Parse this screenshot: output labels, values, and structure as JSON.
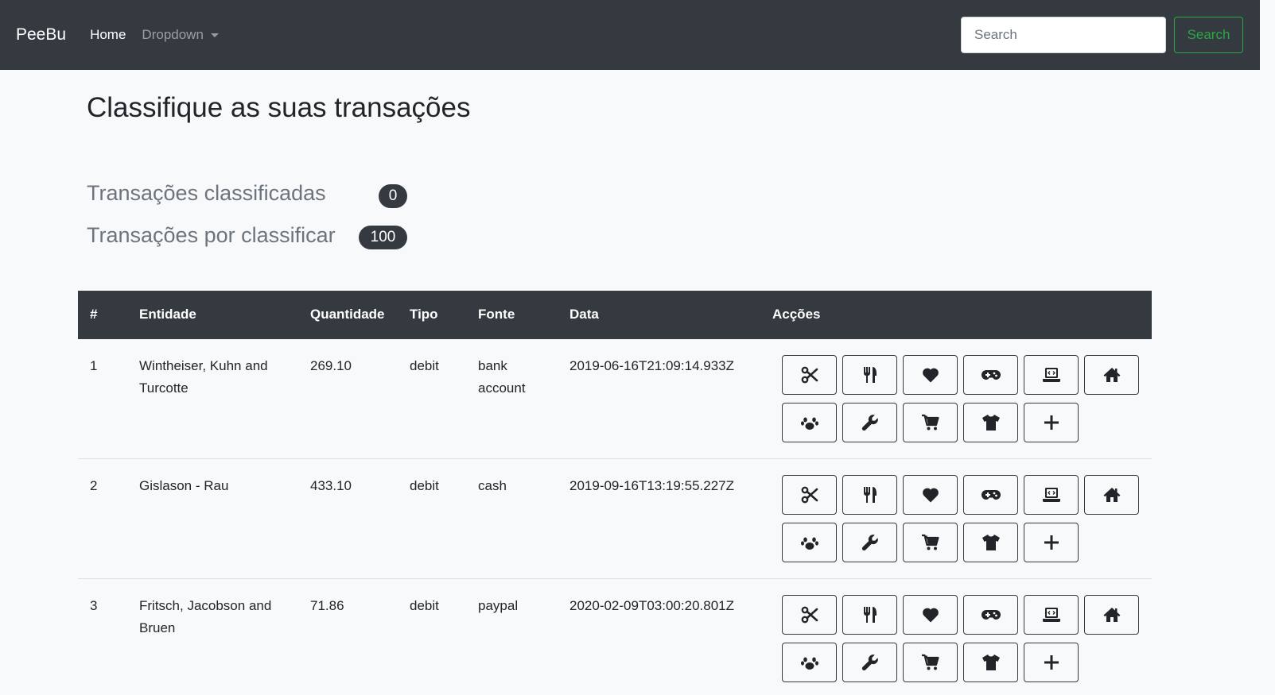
{
  "navbar": {
    "brand": "PeeBu",
    "home": "Home",
    "dropdown": "Dropdown",
    "search_placeholder": "Search",
    "search_button": "Search"
  },
  "page": {
    "title": "Classifique as suas transações"
  },
  "stats": {
    "classified_label": "Transações classificadas",
    "classified_count": "0",
    "unclassified_label": "Transações por classificar",
    "unclassified_count": "100"
  },
  "table": {
    "headers": [
      "#",
      "Entidade",
      "Quantidade",
      "Tipo",
      "Fonte",
      "Data",
      "Acções"
    ],
    "action_icons": [
      "scissors-icon",
      "utensils-icon",
      "heart-icon",
      "gamepad-icon",
      "laptop-code-icon",
      "home-icon",
      "paw-icon",
      "wrench-icon",
      "cart-icon",
      "tshirt-icon",
      "plus-icon"
    ],
    "rows": [
      {
        "num": "1",
        "entity": "Wintheiser, Kuhn and Turcotte",
        "qty": "269.10",
        "type": "debit",
        "source": "bank account",
        "date": "2019-06-16T21:09:14.933Z"
      },
      {
        "num": "2",
        "entity": "Gislason - Rau",
        "qty": "433.10",
        "type": "debit",
        "source": "cash",
        "date": "2019-09-16T13:19:55.227Z"
      },
      {
        "num": "3",
        "entity": "Fritsch, Jacobson and Bruen",
        "qty": "71.86",
        "type": "debit",
        "source": "paypal",
        "date": "2020-02-09T03:00:20.801Z"
      }
    ]
  }
}
